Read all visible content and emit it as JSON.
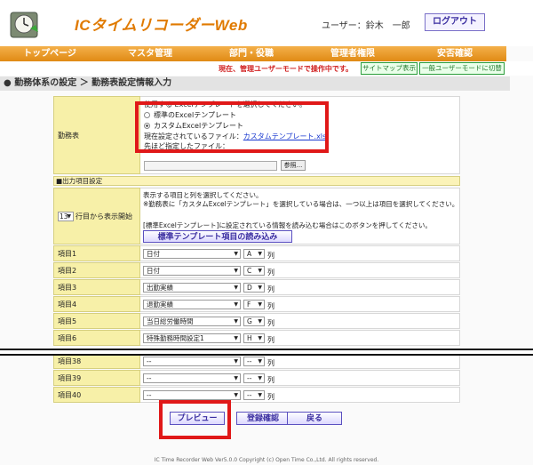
{
  "header": {
    "app_title": "ICタイムリコーダーWeb",
    "user_label": "ユーザー：鈴木　一郎",
    "logout": "ログアウト"
  },
  "nav": [
    "トップページ",
    "マスタ管理",
    "部門・役職",
    "管理者権限",
    "安否確認"
  ],
  "modebar": {
    "message": "現在、管理ユーザーモードで操作中です。",
    "sitemap": "サイトマップ表示",
    "switch_user": "一般ユーザーモードに切替"
  },
  "breadcrumb": "●  勤務体系の設定 ＞ 勤務表設定情報入力",
  "kinmu": {
    "label": "勤務表",
    "instruction": "使用する Excelテンプレートを選択してください。",
    "option_standard": "標準のExcelテンプレート",
    "option_custom": "カスタムExcelテンプレート",
    "current_file_label": "現在設定されているファイル：",
    "current_file_link": "カスタムテンプレート.xls",
    "previous_file_label": "先ほど指定したファイル：",
    "browse": "参照..."
  },
  "output_section": "■出力項目設定",
  "display_start": {
    "value": "13",
    "label_suffix": "行目から表示開始",
    "help1": "表示する項目と列を選択してください。",
    "help2": "※勤務表に「カスタムExcelテンプレート」を選択している場合は、一つ以上は項目を選択してください。",
    "help3": "[標準Excelテンプレート]に設定されている情報を読み込む場合はこのボタンを押してください。",
    "load_button": "標準テンプレート項目の読み込み"
  },
  "col_suffix": "列",
  "items": [
    {
      "label": "項目1",
      "item": "日付",
      "col": "A"
    },
    {
      "label": "項目2",
      "item": "日付",
      "col": "C"
    },
    {
      "label": "項目3",
      "item": "出勤実績",
      "col": "D"
    },
    {
      "label": "項目4",
      "item": "退勤実績",
      "col": "F"
    },
    {
      "label": "項目5",
      "item": "当日総労働時間",
      "col": "G"
    },
    {
      "label": "項目6",
      "item": "特殊勤務時間設定1",
      "col": "H"
    },
    {
      "label": "項目38",
      "item": "--",
      "col": "--"
    },
    {
      "label": "項目39",
      "item": "--",
      "col": "--"
    },
    {
      "label": "項目40",
      "item": "--",
      "col": "--"
    }
  ],
  "actions": {
    "preview": "プレビュー",
    "register": "登録確認",
    "back": "戻る"
  },
  "footer": "IC Time Recorder Web Ver5.0.0 Copyright (c) Open Time Co.,Ltd. All rights reserved.",
  "colors": {
    "accent": "#e07a00",
    "highlight": "#e01818",
    "label_bg": "#f7f0a8"
  }
}
